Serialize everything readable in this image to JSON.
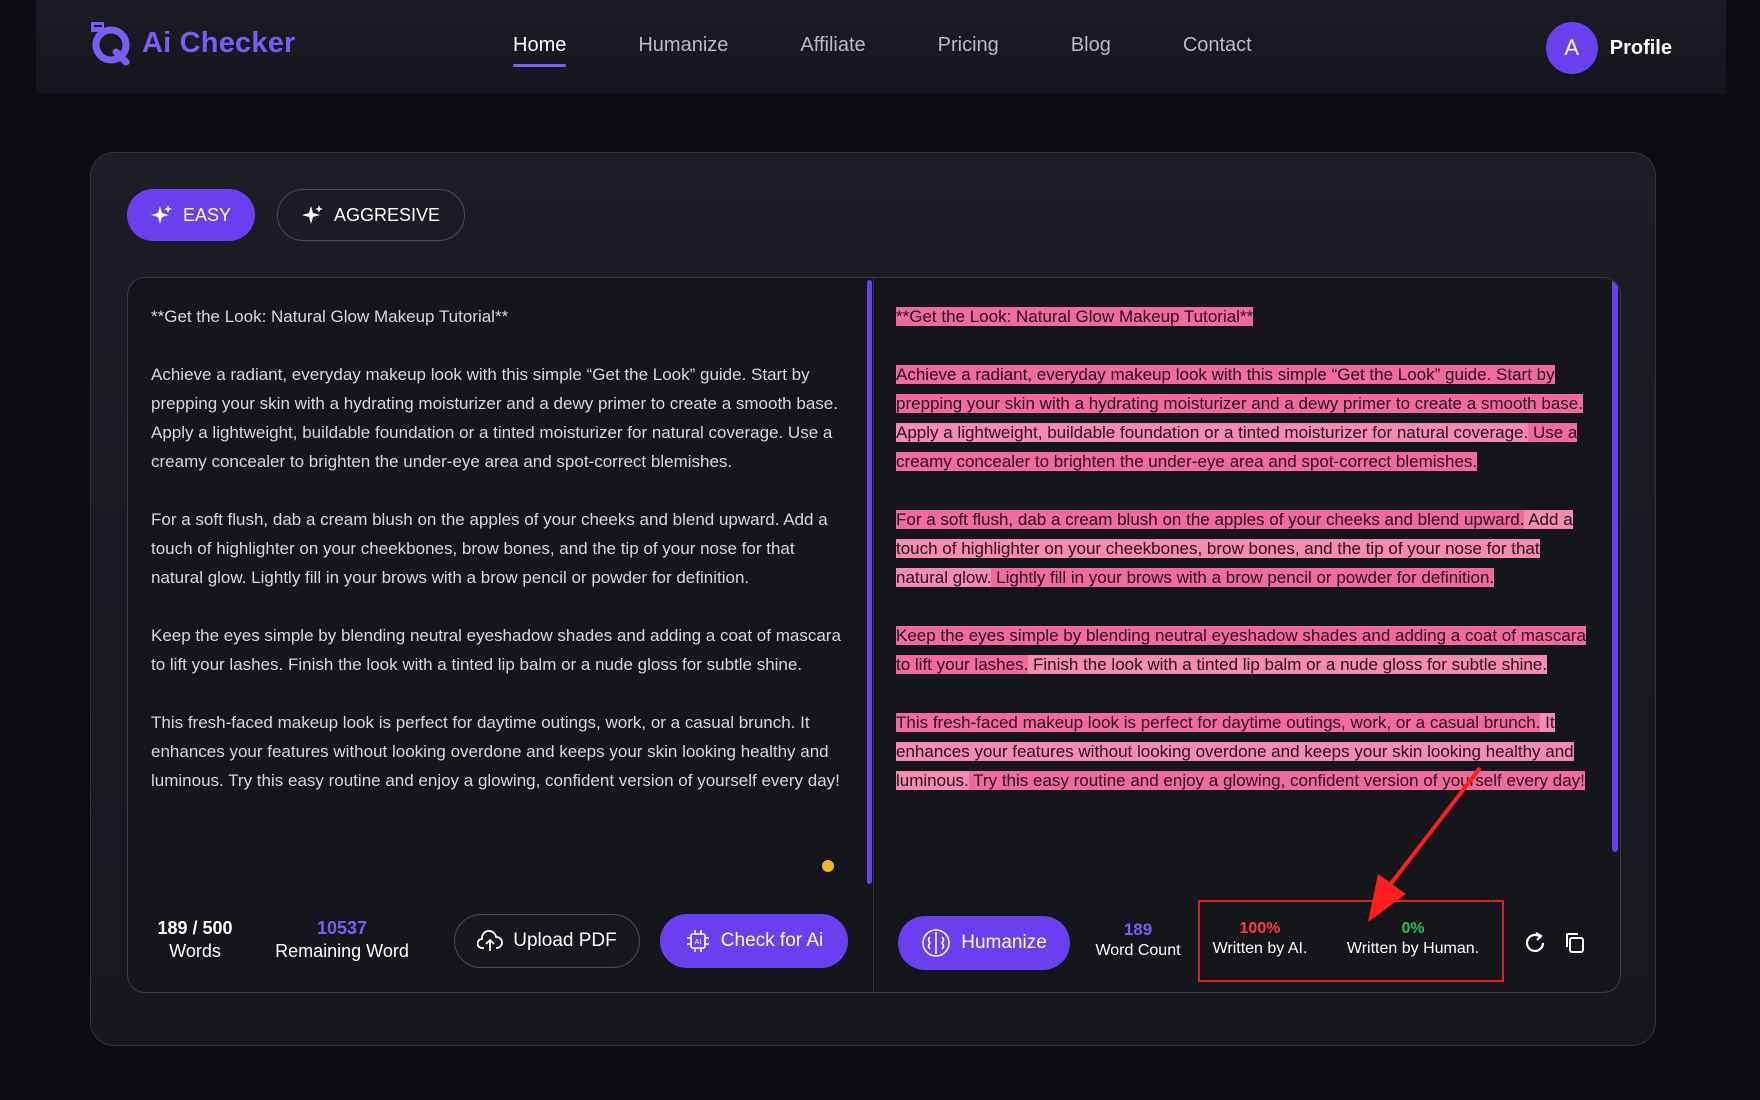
{
  "brand": {
    "name": "Ai Checker",
    "accent": "#6a3ff0"
  },
  "nav": {
    "items": [
      {
        "label": "Home",
        "active": true
      },
      {
        "label": "Humanize",
        "active": false
      },
      {
        "label": "Affiliate",
        "active": false
      },
      {
        "label": "Pricing",
        "active": false
      },
      {
        "label": "Blog",
        "active": false
      },
      {
        "label": "Contact",
        "active": false
      }
    ],
    "profile": {
      "initial": "A",
      "label": "Profile"
    }
  },
  "modes": {
    "easy": "EASY",
    "aggressive": "AGGRESIVE",
    "selected": "EASY"
  },
  "input": {
    "paragraphs": [
      "**Get the Look: Natural Glow Makeup Tutorial**",
      "Achieve a radiant, everyday makeup look with this simple “Get the Look” guide. Start by prepping your skin with a hydrating moisturizer and a dewy primer to create a smooth base. Apply a lightweight, buildable foundation or a tinted moisturizer for natural coverage. Use a creamy concealer to brighten the under-eye area and spot-correct blemishes.",
      "For a soft flush, dab a cream blush on the apples of your cheeks and blend upward. Add a touch of highlighter on your cheekbones, brow bones, and the tip of your nose for that natural glow. Lightly fill in your brows with a brow pencil or powder for definition.",
      "Keep the eyes simple by blending neutral eyeshadow shades and adding a coat of mascara to lift your lashes. Finish the look with a tinted lip balm or a nude gloss for subtle shine.",
      "This fresh-faced makeup look is perfect for daytime outings, work, or a casual brunch. It enhances your features without looking overdone and keeps your skin looking healthy and luminous. Try this easy routine and enjoy a glowing, confident version of yourself every day!"
    ],
    "word_count": "189 / 500",
    "words_label": "Words",
    "remaining": "10537",
    "remaining_label": "Remaining Word",
    "upload_label": "Upload PDF",
    "check_label": "Check for Ai"
  },
  "output": {
    "paragraphs": [
      [
        {
          "t": "**Get the Look: Natural Glow Makeup Tutorial**",
          "h": 1
        }
      ],
      [
        {
          "t": "Achieve a radiant, everyday makeup look with this simple “Get the Look” guide. Start by prepping your skin with a hydrating moisturizer and a dewy primer to create a smooth base.",
          "h": 1
        },
        {
          "t": " Apply a lightweight, buildable foundation or a tinted moisturizer for natural coverage.",
          "h": 2
        },
        {
          "t": " Use a creamy concealer to brighten the under-eye area and spot-correct blemishes.",
          "h": 1
        }
      ],
      [
        {
          "t": "For a soft flush, dab a cream blush on the apples of your cheeks and blend upward.",
          "h": 1
        },
        {
          "t": " Add a touch of highlighter on your cheekbones, brow bones, and the tip of your nose for that natural glow.",
          "h": 2
        },
        {
          "t": " Lightly fill in your brows with a brow pencil or powder for definition.",
          "h": 1
        }
      ],
      [
        {
          "t": "Keep the eyes simple by blending neutral eyeshadow shades and adding a coat of mascara to lift your lashes.",
          "h": 1
        },
        {
          "t": " Finish the look with a tinted lip balm or a nude gloss for subtle shine.",
          "h": 2
        }
      ],
      [
        {
          "t": "This fresh-faced makeup look is perfect for daytime outings, work, or a casual brunch.",
          "h": 1
        },
        {
          "t": " It enhances your features without looking overdone and keeps your skin looking healthy and luminous.",
          "h": 2
        },
        {
          "t": " Try this easy routine and enjoy a glowing, confident version of yourself every day!",
          "h": 1
        }
      ]
    ],
    "humanize_label": "Humanize",
    "word_count": "189",
    "word_count_label": "Word Count",
    "ai_percent": "100%",
    "ai_label": "Written by AI.",
    "human_percent": "0%",
    "human_label": "Written by Human."
  },
  "colors": {
    "ai": "#ff3b3b",
    "human": "#26c058",
    "highlight": "#f06a9c",
    "highlight_alt": "#f48bb1"
  },
  "icons": {
    "refresh": "refresh-icon",
    "copy": "copy-icon",
    "upload": "cloud-upload-icon",
    "check": "ai-chip-icon",
    "humanize": "brain-icon",
    "mode": "sparkle-icon"
  }
}
